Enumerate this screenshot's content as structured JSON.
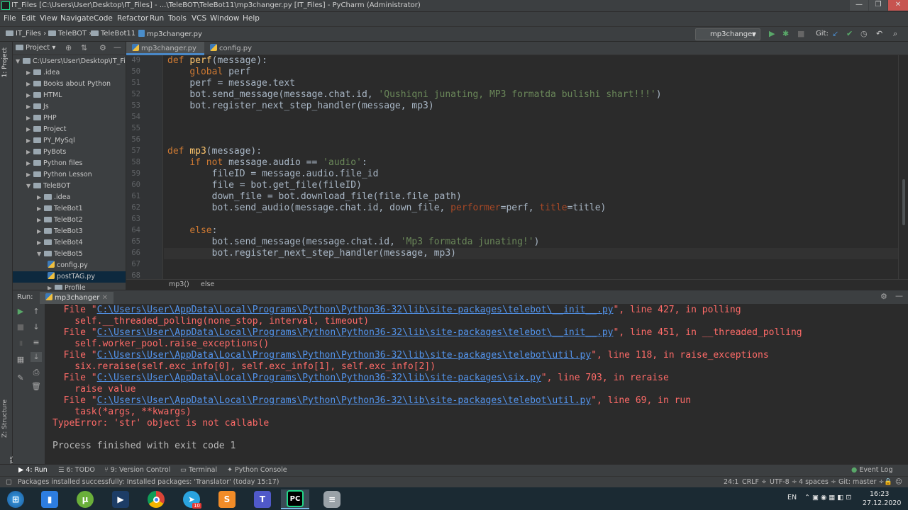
{
  "window": {
    "title": "IT_Files [C:\\Users\\User\\Desktop\\IT_Files] - ...\\TeleBOT\\TeleBot11\\mp3changer.py [IT_Files] - PyCharm (Administrator)",
    "minimize": "—",
    "maximize": "❐",
    "close": "✕"
  },
  "menu": [
    "File",
    "Edit",
    "View",
    "Navigate",
    "Code",
    "Refactor",
    "Run",
    "Tools",
    "VCS",
    "Window",
    "Help"
  ],
  "breadcrumb": [
    "IT_Files",
    "TeleBOT",
    "TeleBot11",
    "mp3changer.py"
  ],
  "run_config": "mp3changer",
  "git_label": "Git:",
  "project_panel": {
    "title": "Project",
    "root": "C:\\Users\\User\\Desktop\\IT_Files",
    "items": [
      {
        "label": ".idea",
        "depth": 1
      },
      {
        "label": "Books about Python",
        "depth": 1
      },
      {
        "label": "HTML",
        "depth": 1
      },
      {
        "label": "Js",
        "depth": 1
      },
      {
        "label": "PHP",
        "depth": 1
      },
      {
        "label": "Project",
        "depth": 1
      },
      {
        "label": "PY_MySql",
        "depth": 1
      },
      {
        "label": "PyBots",
        "depth": 1
      },
      {
        "label": "Python files",
        "depth": 1
      },
      {
        "label": "Python Lesson",
        "depth": 1
      },
      {
        "label": "TeleBOT",
        "depth": 1
      },
      {
        "label": ".idea",
        "depth": 2
      },
      {
        "label": "TeleBot1",
        "depth": 2
      },
      {
        "label": "TeleBot2",
        "depth": 2
      },
      {
        "label": "TeleBot3",
        "depth": 2
      },
      {
        "label": "TeleBot4",
        "depth": 2
      },
      {
        "label": "TeleBot5",
        "depth": 2
      },
      {
        "label": "config.py",
        "depth": 3
      },
      {
        "label": "postTAG.py",
        "depth": 3
      },
      {
        "label": "Profile",
        "depth": 3
      }
    ]
  },
  "editor_tabs": [
    "mp3changer.py",
    "config.py"
  ],
  "code": {
    "line_numbers": [
      "49",
      "50",
      "51",
      "52",
      "53",
      "54",
      "55",
      "56",
      "57",
      "58",
      "59",
      "60",
      "61",
      "62",
      "63",
      "64",
      "65",
      "66",
      "67",
      "68"
    ],
    "lines": {
      "l49_def": "def ",
      "l49_fn": "perf",
      "l49_rest": "(message):",
      "l50_kw": "global ",
      "l50_rest": "perf",
      "l51": "perf = message.text",
      "l52_a": "bot.send_message(message.chat.id, ",
      "l52_str": "'Qushiqni junating, MP3 formatda bulishi shart!!!'",
      "l52_b": ")",
      "l53": "bot.register_next_step_handler(message, mp3)",
      "l57_def": "def ",
      "l57_fn": "mp3",
      "l57_rest": "(message):",
      "l58_kw": "if not ",
      "l58_a": "message.audio == ",
      "l58_str": "'audio'",
      "l58_b": ":",
      "l59": "fileID = message.audio.file_id",
      "l60": "file = bot.get_file(fileID)",
      "l61": "down_file = bot.download_file(file.file_path)",
      "l62_a": "bot.send_audio(message.chat.id, down_file, ",
      "l62_p1": "performer",
      "l62_b": "=perf, ",
      "l62_p2": "title",
      "l62_c": "=title)",
      "l64_kw": "else",
      "l64_b": ":",
      "l65_a": "bot.send_message(message.chat.id, ",
      "l65_str": "'Mp3 formatda junating!'",
      "l65_b": ")",
      "l66": "bot.register_next_step_handler(message, mp3)"
    }
  },
  "editor_breadcrumb": [
    "mp3()",
    "else"
  ],
  "run_panel": {
    "label": "Run:",
    "tab": "mp3changer",
    "output": [
      {
        "pre": "  File \"",
        "link": "C:\\Users\\User\\AppData\\Local\\Programs\\Python\\Python36-32\\lib\\site-packages\\telebot\\__init__.py",
        "post": "\", line 427, in polling"
      },
      {
        "text": "    self.__threaded_polling(none_stop, interval, timeout)"
      },
      {
        "pre": "  File \"",
        "link": "C:\\Users\\User\\AppData\\Local\\Programs\\Python\\Python36-32\\lib\\site-packages\\telebot\\__init__.py",
        "post": "\", line 451, in __threaded_polling"
      },
      {
        "text": "    self.worker_pool.raise_exceptions()"
      },
      {
        "pre": "  File \"",
        "link": "C:\\Users\\User\\AppData\\Local\\Programs\\Python\\Python36-32\\lib\\site-packages\\telebot\\util.py",
        "post": "\", line 118, in raise_exceptions"
      },
      {
        "text": "    six.reraise(self.exc_info[0], self.exc_info[1], self.exc_info[2])"
      },
      {
        "pre": "  File \"",
        "link": "C:\\Users\\User\\AppData\\Local\\Programs\\Python\\Python36-32\\lib\\site-packages\\six.py",
        "post": "\", line 703, in reraise"
      },
      {
        "text": "    raise value"
      },
      {
        "pre": "  File \"",
        "link": "C:\\Users\\User\\AppData\\Local\\Programs\\Python\\Python36-32\\lib\\site-packages\\telebot\\util.py",
        "post": "\", line 69, in run"
      },
      {
        "text": "    task(*args, **kwargs)"
      },
      {
        "text": "TypeError: 'str' object is not callable"
      },
      {
        "text": ""
      },
      {
        "text": "Process finished with exit code 1",
        "white": true
      }
    ]
  },
  "tool_tabs": {
    "run": "4: Run",
    "todo": "6: TODO",
    "vc": "9: Version Control",
    "terminal": "Terminal",
    "console": "Python Console",
    "event_log": "Event Log"
  },
  "side_tabs": {
    "project": "1: Project",
    "structure": "Z: Structure",
    "favorites": "2: Favorites"
  },
  "status": {
    "message": "Packages installed successfully: Installed packages: 'Translator' (today 15:17)",
    "position": "24:1",
    "line_sep": "CRLF ÷",
    "encoding": "UTF-8 ÷",
    "indent": "4 spaces ÷",
    "git": "Git: master ÷"
  },
  "taskbar": {
    "lang": "EN",
    "time": "16:23",
    "date": "27.12.2020",
    "telegram_badge": "10"
  },
  "colors": {
    "accent": "#4a88c7",
    "error": "#ff6b68",
    "link": "#5394ec",
    "keyword": "#cc7832",
    "string": "#6a8759"
  }
}
